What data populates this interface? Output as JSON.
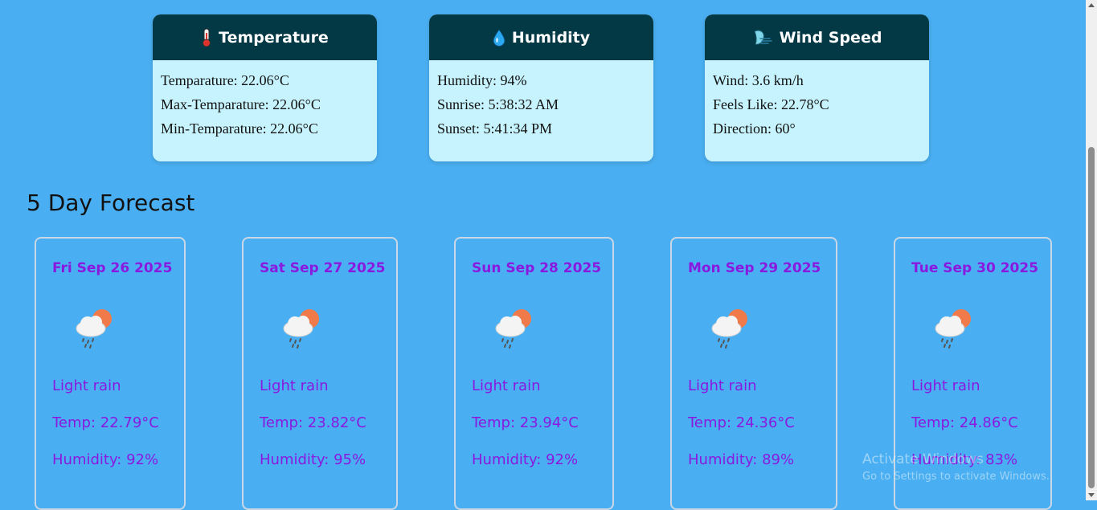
{
  "cards": [
    {
      "title": "Temperature",
      "icon": "thermometer-icon",
      "lines": [
        "Temparature: 22.06°C",
        "Max-Temparature: 22.06°C",
        "Min-Temparature: 22.06°C"
      ]
    },
    {
      "title": "Humidity",
      "icon": "droplet-icon",
      "lines": [
        "Humidity: 94%",
        "Sunrise: 5:38:32 AM",
        "Sunset: 5:41:34 PM"
      ]
    },
    {
      "title": "Wind Speed",
      "icon": "wind-icon",
      "lines": [
        "Wind: 3.6 km/h",
        "Feels Like: 22.78°C",
        "Direction: 60°"
      ]
    }
  ],
  "forecast": {
    "title": "5 Day Forecast",
    "days": [
      {
        "date": "Fri Sep 26 2025",
        "desc": "Light rain",
        "temp": "Temp: 22.79°C",
        "humidity": "Humidity: 92%",
        "icon": "cloud-rain-sun-icon"
      },
      {
        "date": "Sat Sep 27 2025",
        "desc": "Light rain",
        "temp": "Temp: 23.82°C",
        "humidity": "Humidity: 95%",
        "icon": "cloud-rain-sun-icon"
      },
      {
        "date": "Sun Sep 28 2025",
        "desc": "Light rain",
        "temp": "Temp: 23.94°C",
        "humidity": "Humidity: 92%",
        "icon": "cloud-rain-sun-icon"
      },
      {
        "date": "Mon Sep 29 2025",
        "desc": "Light rain",
        "temp": "Temp: 24.36°C",
        "humidity": "Humidity: 89%",
        "icon": "cloud-rain-sun-icon"
      },
      {
        "date": "Tue Sep 30 2025",
        "desc": "Light rain",
        "temp": "Temp: 24.86°C",
        "humidity": "Humidity: 83%",
        "icon": "cloud-rain-sun-icon"
      }
    ]
  },
  "watermark": {
    "line1": "Activate Windows",
    "line2": "Go to Settings to activate Windows."
  },
  "colors": {
    "background": "#4aaff2",
    "card_header": "#033845",
    "card_body": "#c6f3fd",
    "forecast_text": "#8a19e0"
  }
}
